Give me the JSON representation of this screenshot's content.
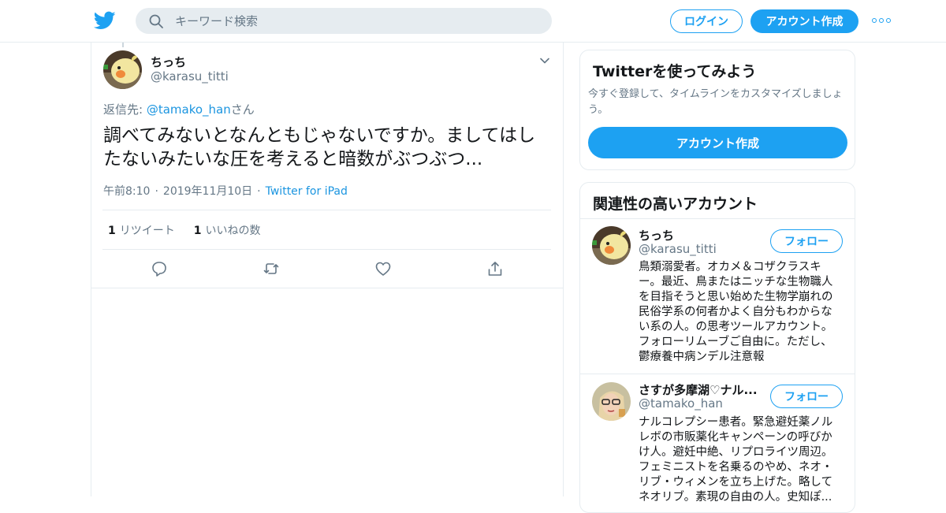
{
  "header": {
    "search_placeholder": "キーワード検索",
    "login_label": "ログイン",
    "signup_label": "アカウント作成"
  },
  "tweet": {
    "author_name": "ちっち",
    "author_handle": "@karasu_titti",
    "reply_prefix": "返信先: ",
    "reply_mention": "@tamako_han",
    "reply_suffix": "さん",
    "text": "調べてみないとなんともじゃないですか。ましてはしたないみたいな圧を考えると暗数がぶつぶつ...",
    "time": "午前8:10",
    "date": "2019年11月10日",
    "source": "Twitter for iPad",
    "retweet_count": "1",
    "retweet_label": "リツイート",
    "like_count": "1",
    "like_label": "いいねの数"
  },
  "signup_card": {
    "title": "Twitterを使ってみよう",
    "subtitle": "今すぐ登録して、タイムラインをカスタマイズしましょう。",
    "button_label": "アカウント作成"
  },
  "related": {
    "title": "関連性の高いアカウント",
    "accounts": [
      {
        "name": "ちっち",
        "handle": "@karasu_titti",
        "follow_label": "フォロー",
        "bio": "鳥類溺愛者。オカメ＆コザクラスキー。最近、鳥またはニッチな生物職人を目指そうと思い始めた生物学崩れの民俗学系の何者かよく自分もわからない系の人。の思考ツールアカウント。フォローリムーブご自由に。ただし、鬱療養中病ンデル注意報"
      },
      {
        "name": "さすが多摩湖♡ナル...",
        "handle": "@tamako_han",
        "follow_label": "フォロー",
        "bio": "ナルコレプシー患者。緊急避妊薬ノルレボの市販薬化キャンペーンの呼びかけ人。避妊中絶、リプロライツ周辺。フェミニストを名乗るのやめ、ネオ・リブ・ウィメンを立ち上げた。略してネオリブ。素現の自由の人。史知ぽ..."
      }
    ]
  },
  "colors": {
    "accent": "#1da1f2",
    "link": "#1b95e0",
    "muted": "#657786",
    "border": "#e6ecf0"
  }
}
